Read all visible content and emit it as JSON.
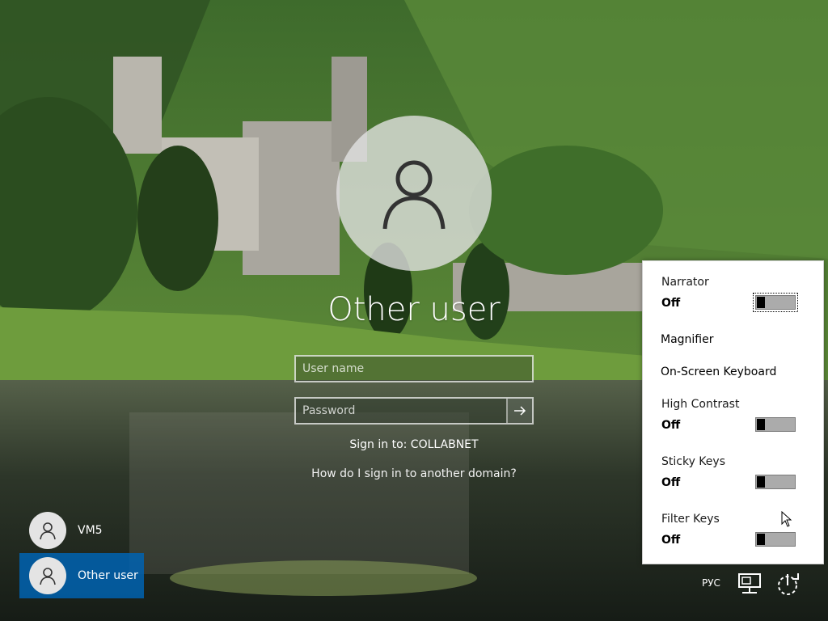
{
  "login": {
    "user_title": "Other user",
    "username_placeholder": "User name",
    "password_placeholder": "Password",
    "sign_in_to": "Sign in to: COLLABNET",
    "help_link": "How do I sign in to another domain?"
  },
  "users": [
    {
      "label": "VM5"
    },
    {
      "label": "Other user"
    }
  ],
  "ease_of_access": {
    "narrator": {
      "title": "Narrator",
      "state": "Off"
    },
    "magnifier": {
      "title": "Magnifier"
    },
    "on_screen_keyboard": {
      "title": "On-Screen Keyboard"
    },
    "high_contrast": {
      "title": "High Contrast",
      "state": "Off"
    },
    "sticky_keys": {
      "title": "Sticky Keys",
      "state": "Off"
    },
    "filter_keys": {
      "title": "Filter Keys",
      "state": "Off"
    }
  },
  "tray": {
    "language": "РУС",
    "icons": [
      "network-icon",
      "power-icon"
    ]
  },
  "colors": {
    "selected_tile": "#0063b1",
    "panel_background": "#ffffff",
    "toggle_track": "#ababab"
  }
}
